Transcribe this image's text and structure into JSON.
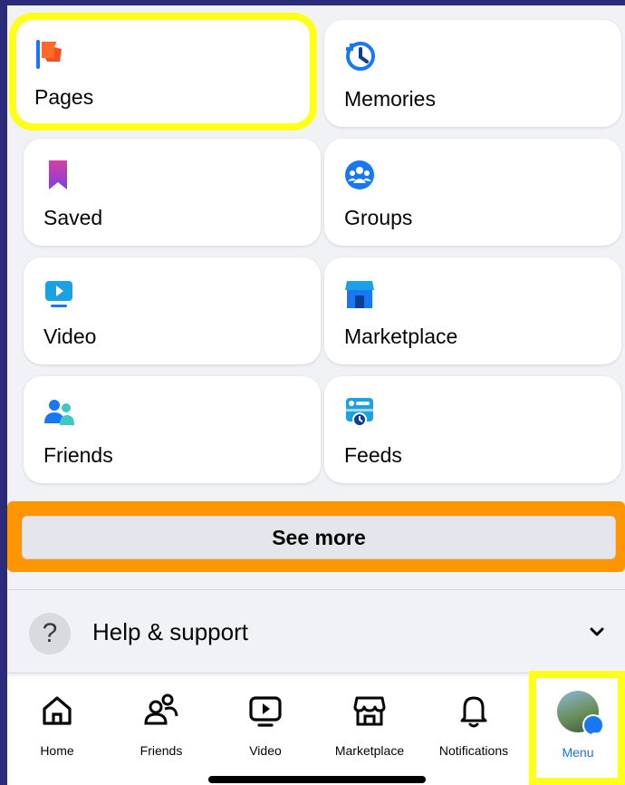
{
  "shortcuts": [
    {
      "label": "Pages",
      "icon": "flag-icon"
    },
    {
      "label": "Memories",
      "icon": "clock-history-icon"
    },
    {
      "label": "Saved",
      "icon": "bookmark-icon"
    },
    {
      "label": "Groups",
      "icon": "groups-icon"
    },
    {
      "label": "Video",
      "icon": "video-icon"
    },
    {
      "label": "Marketplace",
      "icon": "storefront-icon"
    },
    {
      "label": "Friends",
      "icon": "friends-icon"
    },
    {
      "label": "Feeds",
      "icon": "feeds-icon"
    }
  ],
  "see_more": {
    "label": "See more"
  },
  "help": {
    "label": "Help & support",
    "icon": "question-icon"
  },
  "tabs": [
    {
      "label": "Home",
      "icon": "home-icon"
    },
    {
      "label": "Friends",
      "icon": "friends-icon"
    },
    {
      "label": "Video",
      "icon": "video-icon"
    },
    {
      "label": "Marketplace",
      "icon": "storefront-icon"
    },
    {
      "label": "Notifications",
      "icon": "bell-icon"
    },
    {
      "label": "Menu",
      "icon": "avatar",
      "active": true
    }
  ],
  "colors": {
    "highlight_yellow": "#ffff1a",
    "highlight_orange": "#ff9500",
    "accent_blue": "#1877f2"
  }
}
